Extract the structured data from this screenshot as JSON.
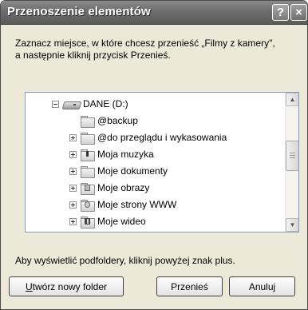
{
  "window": {
    "title": "Przenoszenie elementów",
    "help_label": "?",
    "close_label": "×"
  },
  "instruction": {
    "line1": "Zaznacz miejsce, w które chcesz przenieść „Filmy z kamery\",",
    "line2": "a następnie kliknij przycisk Przenieś."
  },
  "tree": {
    "items": [
      {
        "label": "DANE (D:)",
        "icon": "drive-icon",
        "expander": "minus"
      },
      {
        "label": "@backup",
        "icon": "folder-icon",
        "expander": "none"
      },
      {
        "label": "@do przeglądu i wykasowania",
        "icon": "folder-icon",
        "expander": "plus"
      },
      {
        "label": "Moja muzyka",
        "icon": "music-folder-icon",
        "expander": "plus"
      },
      {
        "label": "Moje dokumenty",
        "icon": "documents-folder-icon",
        "expander": "plus"
      },
      {
        "label": "Moje obrazy",
        "icon": "pictures-folder-icon",
        "expander": "plus"
      },
      {
        "label": "Moje strony WWW",
        "icon": "web-folder-icon",
        "expander": "plus"
      },
      {
        "label": "Moje wideo",
        "icon": "video-folder-icon",
        "expander": "plus"
      }
    ]
  },
  "hint": "Aby wyświetlić podfoldery, kliknij powyżej znak plus.",
  "buttons": {
    "new_folder_prefix": "U",
    "new_folder_rest": "twórz nowy folder",
    "move": "Przenieś",
    "cancel": "Anuluj"
  },
  "scrollbar": {
    "up_glyph": "▲",
    "down_glyph": "▼"
  }
}
